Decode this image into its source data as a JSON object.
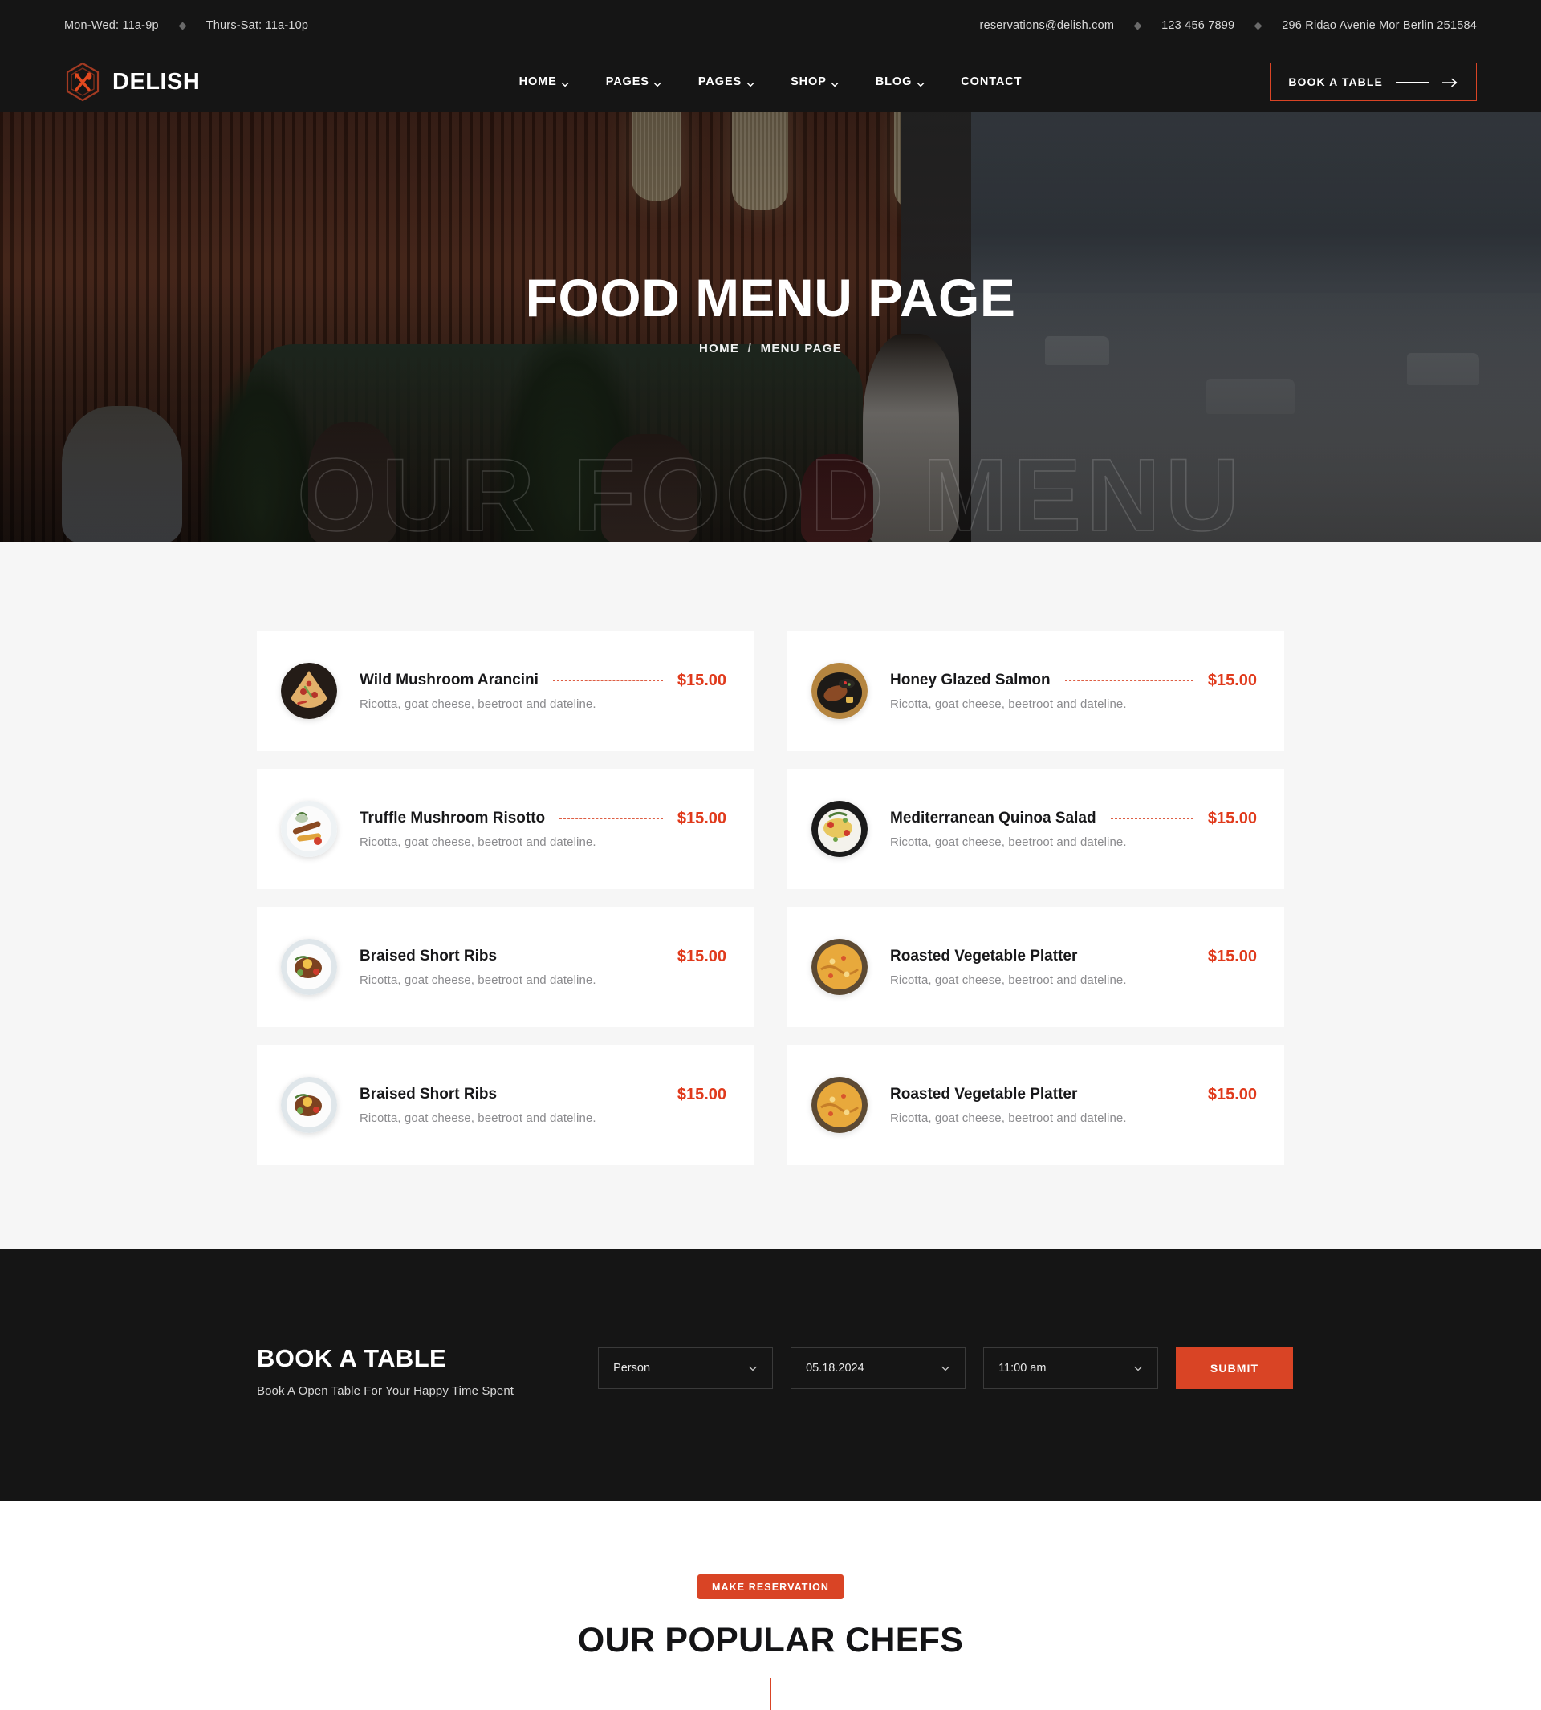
{
  "topbar": {
    "hours": [
      {
        "label": "Mon-Wed: 11a-9p"
      },
      {
        "label": "Thurs-Sat: 11a-10p"
      }
    ],
    "contacts": [
      {
        "label": "reservations@delish.com"
      },
      {
        "label": "123 456 7899"
      },
      {
        "label": "296 Ridao Avenie Mor Berlin 251584"
      }
    ]
  },
  "header": {
    "brand": "DELISH",
    "logo_icon": "hexagon-fork-spoon-icon",
    "nav": [
      {
        "label": "HOME",
        "has_dropdown": true
      },
      {
        "label": "PAGES",
        "has_dropdown": true
      },
      {
        "label": "PAGES",
        "has_dropdown": true
      },
      {
        "label": "SHOP",
        "has_dropdown": true
      },
      {
        "label": "BLOG",
        "has_dropdown": true
      },
      {
        "label": "CONTACT",
        "has_dropdown": false
      }
    ],
    "book_button": "BOOK A TABLE"
  },
  "hero": {
    "title": "FOOD MENU PAGE",
    "breadcrumb_home": "HOME",
    "breadcrumb_sep": "/",
    "breadcrumb_current": "MENU PAGE",
    "watermark": "OUR FOOD MENU"
  },
  "menu": {
    "items": [
      {
        "name": "Wild Mushroom Arancini",
        "price": "$15.00",
        "desc": "Ricotta, goat cheese, beetroot and dateline.",
        "image": "pizza-slices-photo"
      },
      {
        "name": "Honey Glazed Salmon",
        "price": "$15.00",
        "desc": "Ricotta, goat cheese, beetroot and dateline.",
        "image": "grilled-meat-skillet-photo"
      },
      {
        "name": "Truffle Mushroom Risotto",
        "price": "$15.00",
        "desc": "Ricotta, goat cheese, beetroot and dateline.",
        "image": "sausage-platter-photo"
      },
      {
        "name": "Mediterranean Quinoa Salad",
        "price": "$15.00",
        "desc": "Ricotta, goat cheese, beetroot and dateline.",
        "image": "fresh-salad-photo"
      },
      {
        "name": "Braised Short Ribs",
        "price": "$15.00",
        "desc": "Ricotta, goat cheese, beetroot and dateline.",
        "image": "ribs-plate-photo"
      },
      {
        "name": "Roasted Vegetable Platter",
        "price": "$15.00",
        "desc": "Ricotta, goat cheese, beetroot and dateline.",
        "image": "roasted-vegetables-photo"
      },
      {
        "name": "Braised Short Ribs",
        "price": "$15.00",
        "desc": "Ricotta, goat cheese, beetroot and dateline.",
        "image": "ribs-plate-photo"
      },
      {
        "name": "Roasted Vegetable Platter",
        "price": "$15.00",
        "desc": "Ricotta, goat cheese, beetroot and dateline.",
        "image": "roasted-vegetables-photo"
      }
    ]
  },
  "booking": {
    "title": "BOOK A TABLE",
    "subtitle": "Book A Open Table For Your Happy Time Spent",
    "person_value": "Person",
    "date_value": "05.18.2024",
    "time_value": "11:00 am",
    "submit_label": "SUBMIT"
  },
  "chefs": {
    "badge": "MAKE RESERVATION",
    "heading": "OUR POPULAR CHEFS"
  },
  "colors": {
    "accent": "#d94425",
    "price": "#e03a1c",
    "dark": "#151515",
    "section_bg": "#f6f6f6"
  }
}
